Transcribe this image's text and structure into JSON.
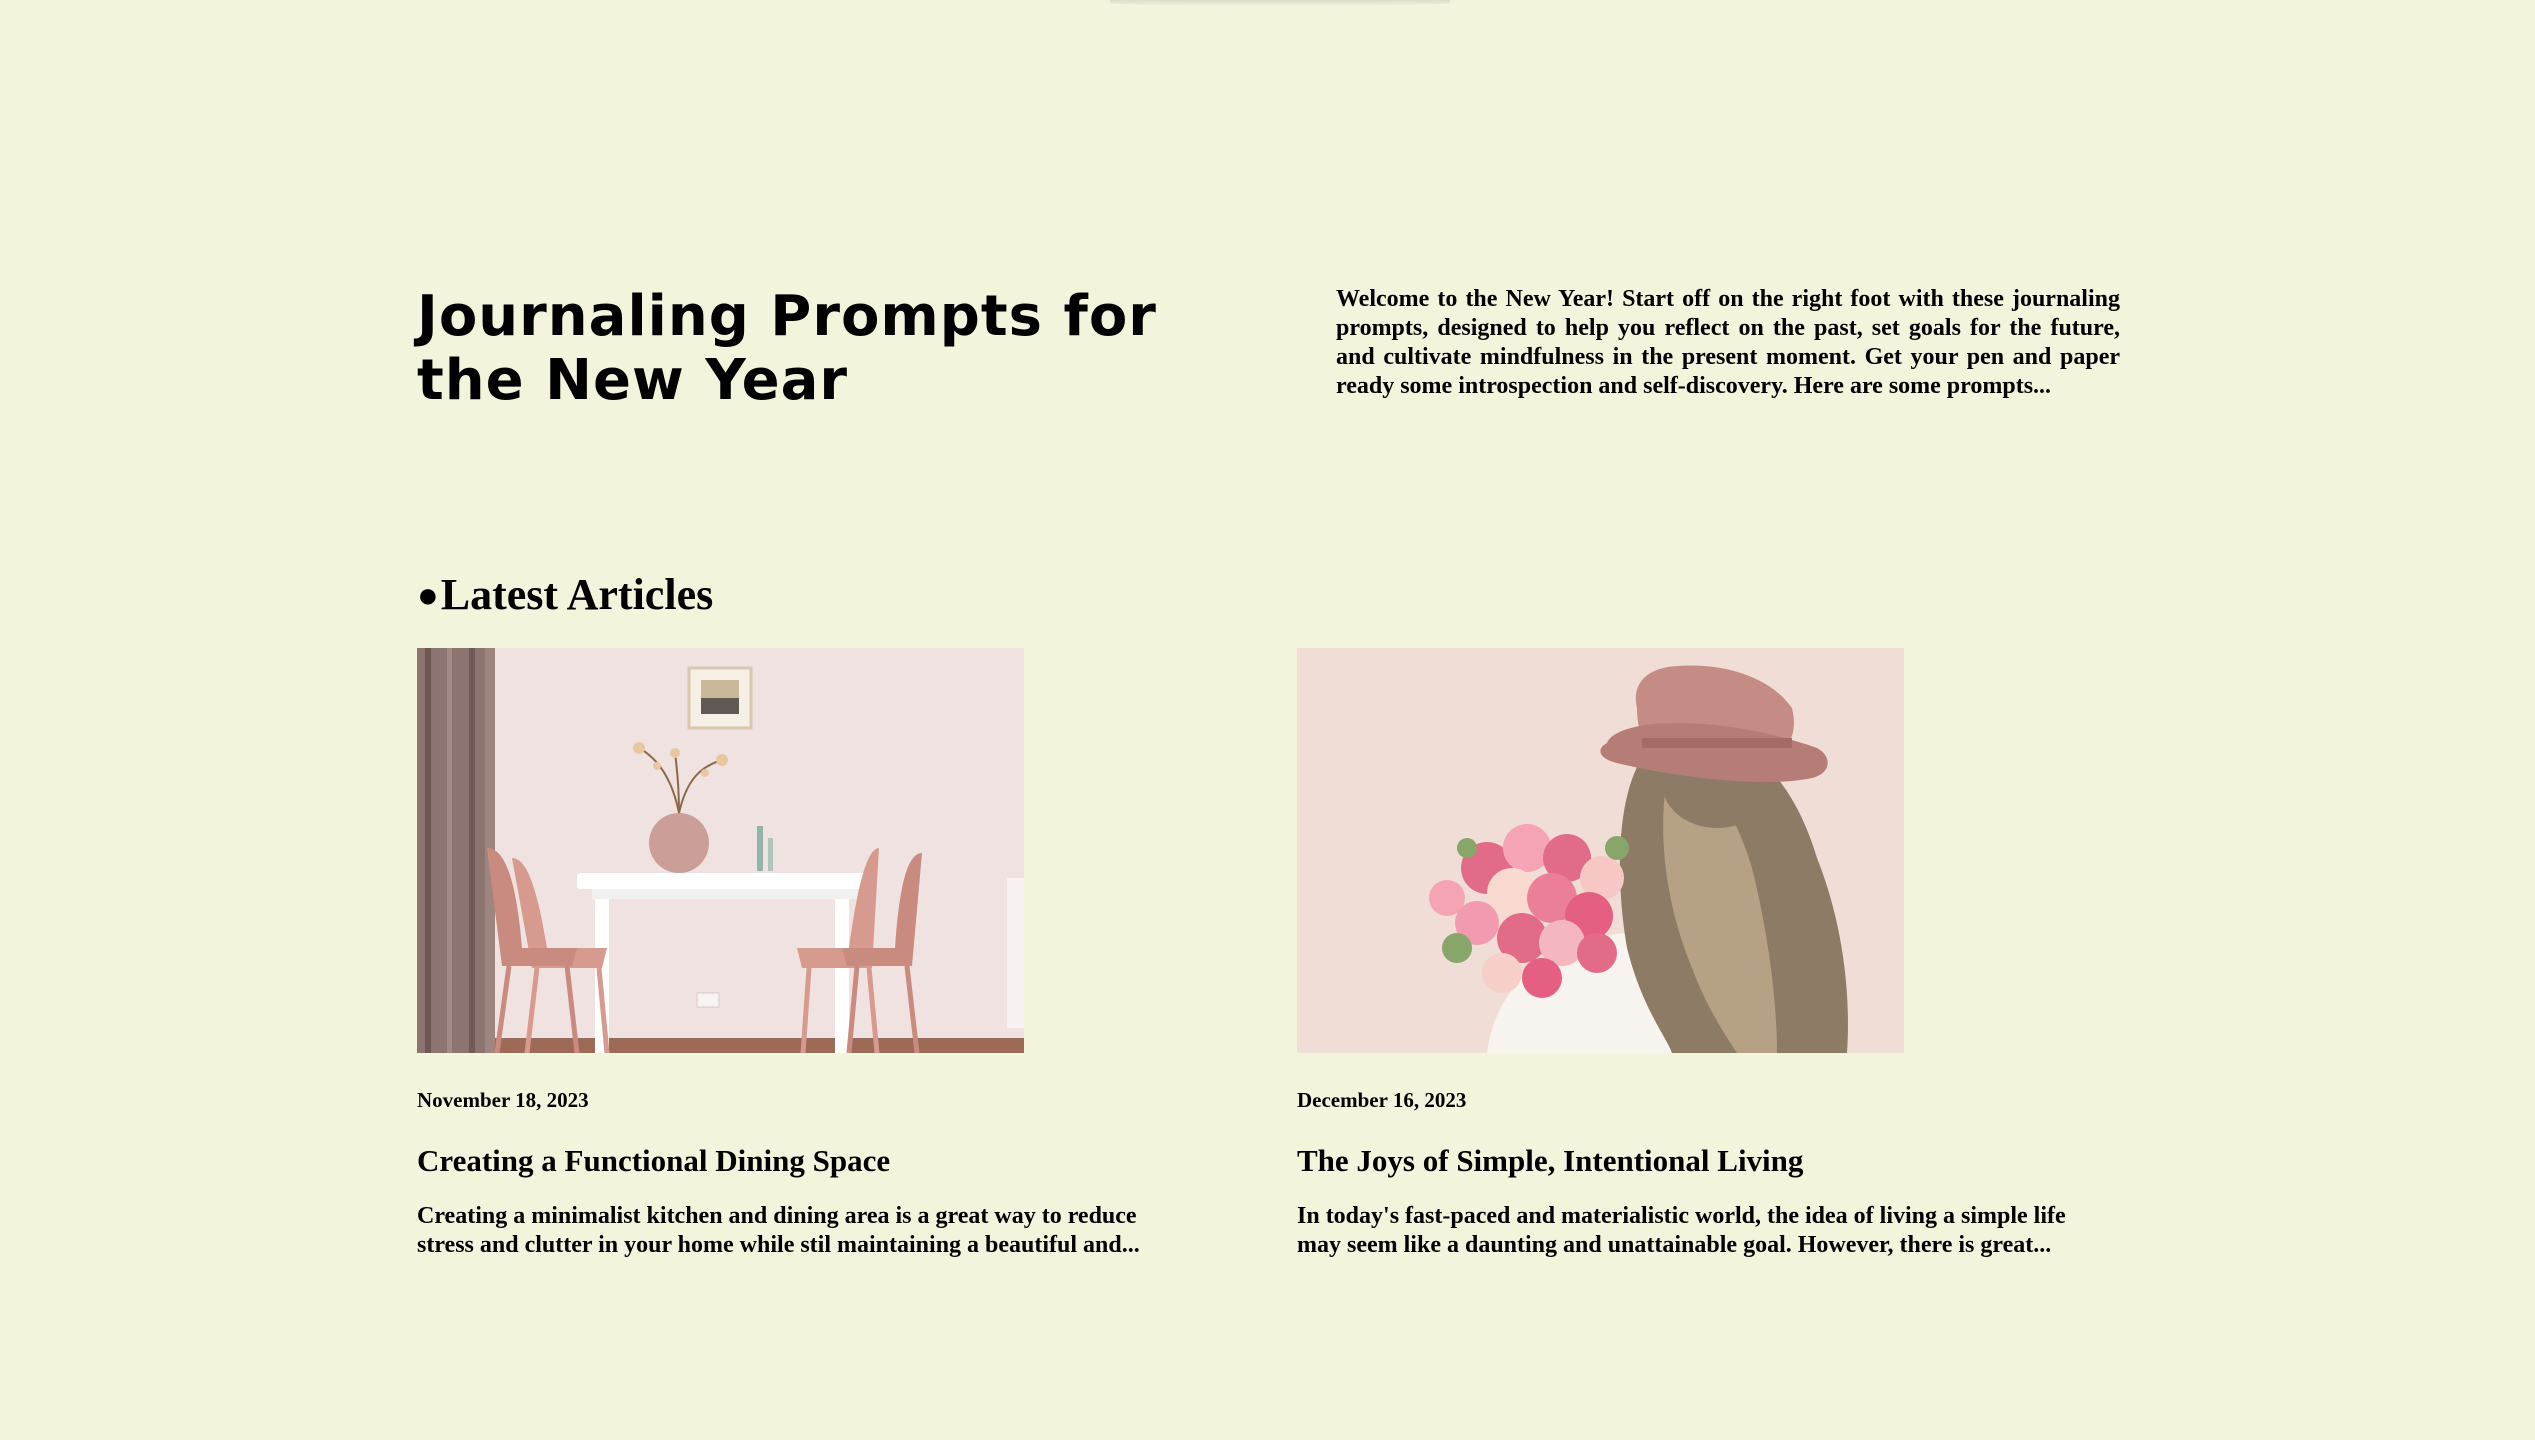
{
  "hero": {
    "title": "Journaling Prompts for the New Year",
    "intro": "Welcome to the New Year! Start off on the right foot with these journaling prompts, designed to help you reflect on the past, set goals for the future, and cultivate mindfulness in the present moment. Get your pen and paper ready some introspection and self-discovery. Here are some prompts..."
  },
  "latest": {
    "bullet": "●",
    "heading": "Latest Articles",
    "articles": [
      {
        "image": "dining-room-photo",
        "date": "November 18, 2023",
        "title": "Creating a Functional Dining Space",
        "excerpt": "Creating a minimalist kitchen and dining area is a great way to reduce stress and clutter in your home while stil maintaining a beautiful and..."
      },
      {
        "image": "woman-with-roses-photo",
        "date": "December 16, 2023",
        "title": "The Joys of Simple, Intentional Living",
        "excerpt": "In today's fast-paced and materialistic world, the idea of living a simple life may seem like a daunting and unattainable goal. However, there is great..."
      }
    ]
  },
  "colors": {
    "background": "#f3f4dc",
    "text": "#000000"
  }
}
